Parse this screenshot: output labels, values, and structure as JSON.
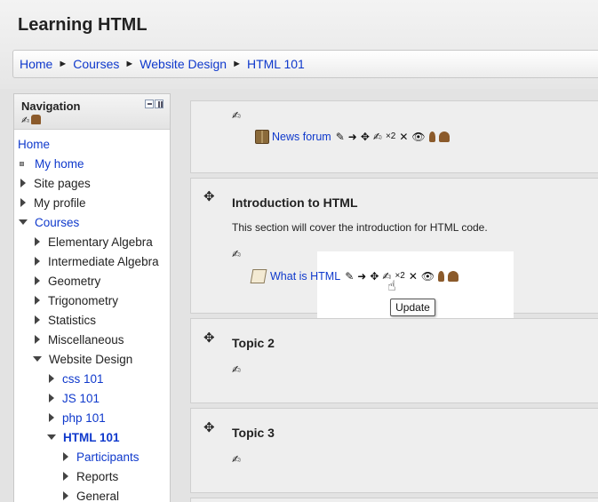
{
  "page": {
    "title": "Learning HTML"
  },
  "breadcrumb": {
    "items": [
      "Home",
      "Courses",
      "Website Design",
      "HTML 101"
    ],
    "separator": "►"
  },
  "navigation": {
    "title": "Navigation",
    "items": [
      {
        "label": "Home"
      },
      {
        "label": "My home"
      },
      {
        "label": "Site pages"
      },
      {
        "label": "My profile"
      },
      {
        "label": "Courses"
      },
      {
        "label": "Elementary Algebra"
      },
      {
        "label": "Intermediate Algebra"
      },
      {
        "label": "Geometry"
      },
      {
        "label": "Trigonometry"
      },
      {
        "label": "Statistics"
      },
      {
        "label": "Miscellaneous"
      },
      {
        "label": "Website Design"
      },
      {
        "label": "css 101"
      },
      {
        "label": "JS 101"
      },
      {
        "label": "php 101"
      },
      {
        "label": "HTML 101"
      },
      {
        "label": "Participants"
      },
      {
        "label": "Reports"
      },
      {
        "label": "General"
      }
    ]
  },
  "sections": [
    {
      "activity": {
        "label": "News forum",
        "groups": "×2"
      }
    },
    {
      "title": "Introduction to HTML",
      "summary": "This section will cover the introduction for HTML code.",
      "activity": {
        "label": "What is HTML",
        "groups": "×2"
      }
    },
    {
      "title": "Topic 2"
    },
    {
      "title": "Topic 3"
    }
  ],
  "tooltip": {
    "text": "Update"
  },
  "icons": {
    "edit": "edit-icon",
    "move": "move-icon",
    "forward": "arrow-right-icon",
    "delete": "delete-icon",
    "visibility": "eye-icon",
    "role": "person-icon",
    "groups": "groups-icon"
  },
  "colors": {
    "link": "#0f39cc",
    "background": "#e3e3e3",
    "section_bg": "#eeeeee"
  }
}
